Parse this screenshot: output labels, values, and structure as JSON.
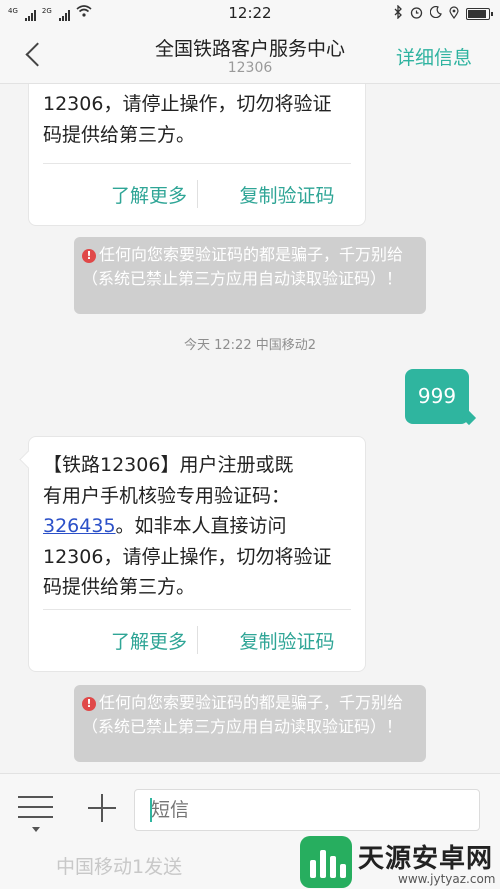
{
  "status_bar": {
    "signal1_label": "4G",
    "signal2_label": "2G",
    "time": "12:22",
    "bluetooth_icon": "bluetooth-icon",
    "alarm_icon": "alarm-icon",
    "moon_icon": "moon-icon",
    "location_icon": "location-icon"
  },
  "header": {
    "title": "全国铁路客户服务中心",
    "subtitle": "12306",
    "details_label": "详细信息"
  },
  "messages": [
    {
      "type": "received",
      "partial": true,
      "text_lines_visible": [
        "12306，请停止操作，切勿将验证",
        "码提供给第三方。"
      ],
      "action_more": "了解更多",
      "action_copy": "复制验证码",
      "warning": "任何向您索要验证码的都是骗子，千万别给（系统已禁止第三方应用自动读取验证码）！"
    },
    {
      "type": "timestamp",
      "text": "今天  12:22  中国移动2"
    },
    {
      "type": "sent",
      "text": "999"
    },
    {
      "type": "received",
      "line1": "【铁路12306】用户注册或既",
      "line2": "有用户手机核验专用验证码：",
      "code": "326435",
      "line3_rest": "。如非本人直接访问",
      "line4": "12306，请停止操作，切勿将验证",
      "line5": "码提供给第三方。",
      "action_more": "了解更多",
      "action_copy": "复制验证码",
      "warning": "任何向您索要验证码的都是骗子，千万别给（系统已禁止第三方应用自动读取验证码）！"
    }
  ],
  "composer": {
    "placeholder": "短信",
    "sim_send_label": "中国移动1发送"
  },
  "watermark": {
    "title": "天源安卓网",
    "url": "www.jytyaz.com"
  },
  "colors": {
    "accent": "#2fb59f",
    "link": "#2b50c8",
    "warning_bg": "#cfcfcf"
  }
}
